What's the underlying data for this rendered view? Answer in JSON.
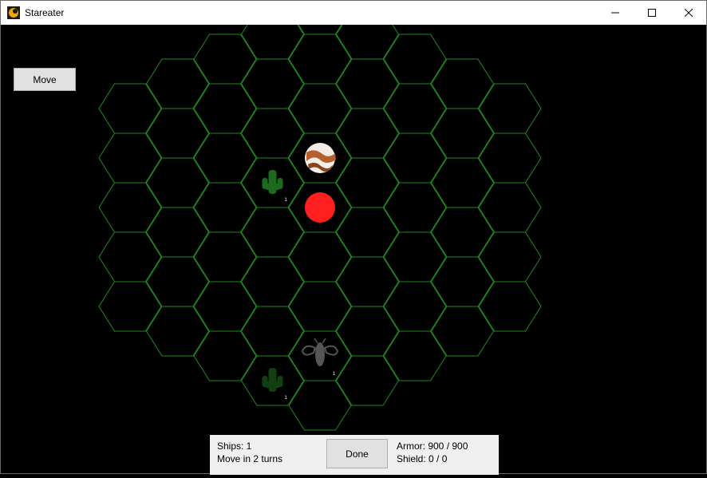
{
  "window": {
    "title": "Stareater"
  },
  "controls": {
    "move_label": "Move"
  },
  "fleet_info": {
    "ships_text": "Ships: 1",
    "move_text": "Move in 2 turns",
    "done_label": "Done",
    "armor_text": "Armor: 900 / 900",
    "shield_text": "Shield: 0 / 0"
  },
  "map": {
    "grid_color": "#1f8a1f",
    "units": [
      {
        "kind": "fleet",
        "icon": "green-ship-icon",
        "count": "1"
      },
      {
        "kind": "fleet",
        "icon": "gray-insect-ship-icon",
        "count": "1"
      },
      {
        "kind": "fleet",
        "icon": "dim-green-ship-icon",
        "count": "1"
      }
    ],
    "planet_color": "#b5602d",
    "star_color": "#ff1f1f"
  }
}
